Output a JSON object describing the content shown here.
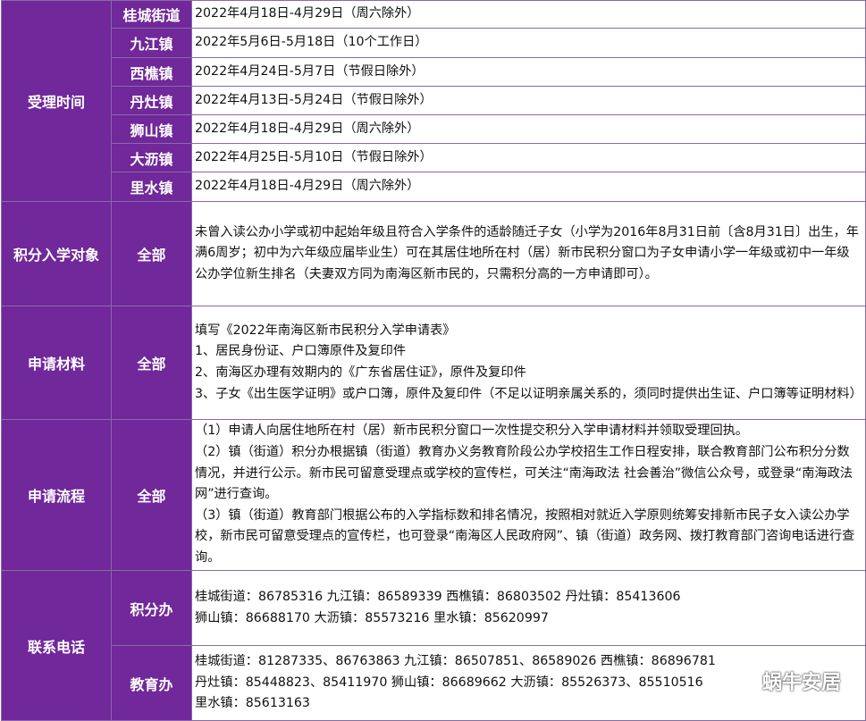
{
  "accept_time": {
    "label": "受理时间",
    "rows": [
      {
        "town": "桂城街道",
        "date": "2022年4月18日-4月29日（周六除外）"
      },
      {
        "town": "九江镇",
        "date": "2022年5月6日-5月18日（10个工作日）"
      },
      {
        "town": "西樵镇",
        "date": "2022年4月24日-5月7日（节假日除外）"
      },
      {
        "town": "丹灶镇",
        "date": "2022年4月13日-5月24日（节假日除外）"
      },
      {
        "town": "狮山镇",
        "date": "2022年4月18日-4月29日（周六除外）"
      },
      {
        "town": "大沥镇",
        "date": "2022年4月25日-5月10日（节假日除外）"
      },
      {
        "town": "里水镇",
        "date": "2022年4月18日-4月29日（周六除外）"
      }
    ]
  },
  "target": {
    "label": "积分入学对象",
    "scope": "全部",
    "text": "未曾入读公办小学或初中起始年级且符合入学条件的适龄随迁子女（小学为2016年8月31日前〔含8月31日〕出生，年满6周岁；初中为六年级应届毕业生）可在其居住地所在村（居）新市民积分窗口为子女申请小学一年级或初中一年级公办学位新生排名（夫妻双方同为南海区新市民的，只需积分高的一方申请即可）。"
  },
  "materials": {
    "label": "申请材料",
    "scope": "全部",
    "lines": [
      "填写《2022年南海区新市民积分入学申请表》",
      "1、居民身份证、户口簿原件及复印件",
      "2、南海区办理有效期内的《广东省居住证》，原件及复印件",
      "3、子女《出生医学证明》或户口簿，原件及复印件（不足以证明亲属关系的，须同时提供出生证、户口簿等证明材料）"
    ]
  },
  "process": {
    "label": "申请流程",
    "scope": "全部",
    "lines": [
      "（1）申请人向居住地所在村（居）新市民积分窗口一次性提交积分入学申请材料并领取受理回执。",
      "（2）镇（街道）积分办根据镇（街道）教育办义务教育阶段公办学校招生工作日程安排，联合教育部门公布积分分数情况，并进行公示。新市民可留意受理点或学校的宣传栏，可关注“南海政法 社会善治”微信公众号，或登录“南海政法网”进行查询。",
      "（3）镇（街道）教育部门根据公布的入学指标数和排名情况，按照相对就近入学原则统筹安排新市民子女入读公办学校，新市民可留意受理点的宣传栏，也可登录“南海区人民政府网”、镇（街道）政务网、拨打教育部门咨询电话进行查询。"
    ]
  },
  "contact": {
    "label": "联系电话",
    "points_office": {
      "label": "积分办",
      "lines": [
        "桂城街道：86785316 九江镇：86589339 西樵镇：86803502 丹灶镇：85413606",
        "狮山镇：86688170 大沥镇：85573216 里水镇：85620997"
      ]
    },
    "education_office": {
      "label": "教育办",
      "lines": [
        "桂城街道：81287335、86763863 九江镇：86507851、86589026 西樵镇：86896781",
        "丹灶镇：85448823、85411970 狮山镇：86689662 大沥镇：85526373、85510516",
        "里水镇：85613163"
      ]
    }
  },
  "watermark": {
    "text": "蜗牛安居",
    "icon": "wechat-icon"
  }
}
